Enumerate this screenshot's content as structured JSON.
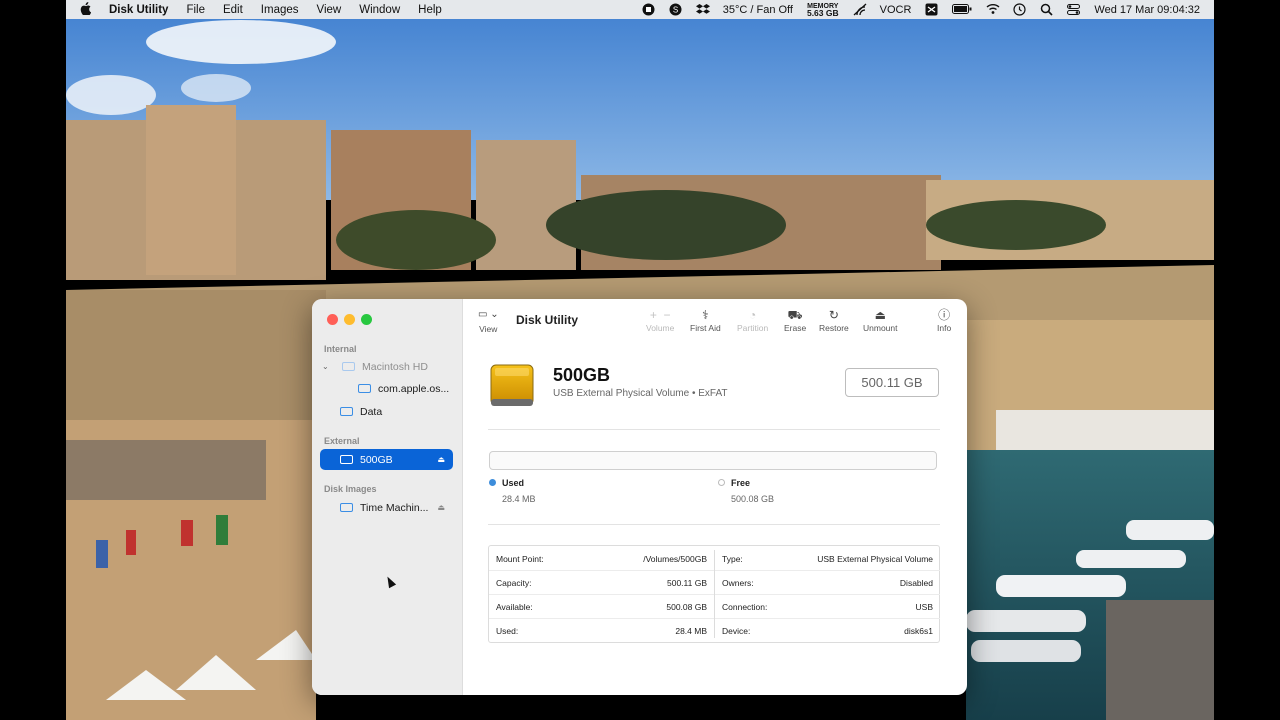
{
  "menubar": {
    "apple": "",
    "app_name": "Disk Utility",
    "menus": [
      "File",
      "Edit",
      "Images",
      "View",
      "Window",
      "Help"
    ],
    "status": {
      "temp_fan": "35°C / Fan Off",
      "memory_label": "MEMORY",
      "memory_value": "5.63 GB",
      "vocr": "VOCR",
      "datetime": "Wed 17 Mar  09:04:32"
    }
  },
  "sidebar": {
    "sections": {
      "internal": "Internal",
      "external": "External",
      "disk_images": "Disk Images"
    },
    "items": [
      {
        "label": "Macintosh HD",
        "state": "dim"
      },
      {
        "label": "com.apple.os...",
        "state": "normal"
      },
      {
        "label": "Data",
        "state": "normal"
      },
      {
        "label": "500GB",
        "state": "selected"
      },
      {
        "label": "Time Machin...",
        "state": "normal"
      }
    ]
  },
  "toolbar": {
    "view_label": "View",
    "title": "Disk Utility",
    "buttons": [
      {
        "label": "Volume",
        "icon": "plus-minus-icon",
        "enabled": false
      },
      {
        "label": "First Aid",
        "icon": "stethoscope-icon",
        "enabled": true
      },
      {
        "label": "Partition",
        "icon": "pie-icon",
        "enabled": false
      },
      {
        "label": "Erase",
        "icon": "erase-icon",
        "enabled": true
      },
      {
        "label": "Restore",
        "icon": "restore-icon",
        "enabled": true
      },
      {
        "label": "Unmount",
        "icon": "eject-icon",
        "enabled": true
      },
      {
        "label": "Info",
        "icon": "info-icon",
        "enabled": true
      }
    ]
  },
  "disk": {
    "name": "500GB",
    "subtitle": "USB External Physical Volume • ExFAT",
    "size": "500.11 GB",
    "used_fraction": 6e-05
  },
  "usage": {
    "used_label": "Used",
    "used_value": "28.4 MB",
    "free_label": "Free",
    "free_value": "500.08 GB"
  },
  "info": {
    "left": [
      {
        "key": "Mount Point:",
        "value": "/Volumes/500GB"
      },
      {
        "key": "Capacity:",
        "value": "500.11 GB"
      },
      {
        "key": "Available:",
        "value": "500.08 GB"
      },
      {
        "key": "Used:",
        "value": "28.4 MB"
      }
    ],
    "right": [
      {
        "key": "Type:",
        "value": "USB External Physical Volume"
      },
      {
        "key": "Owners:",
        "value": "Disabled"
      },
      {
        "key": "Connection:",
        "value": "USB"
      },
      {
        "key": "Device:",
        "value": "disk6s1"
      }
    ]
  },
  "colors": {
    "accent": "#0a64d7",
    "used": "#3d8ddb",
    "disk_icon": "#e9a300"
  }
}
